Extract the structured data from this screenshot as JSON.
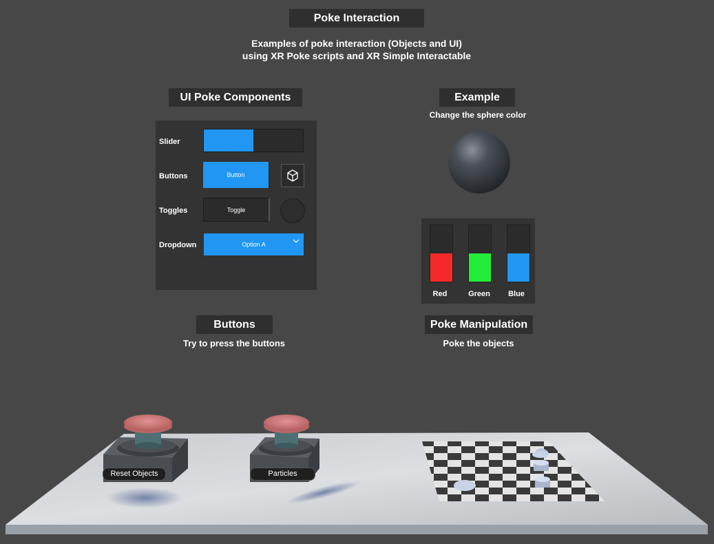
{
  "header": {
    "title": "Poke Interaction",
    "subtitle_line1": "Examples of poke interaction (Objects and UI)",
    "subtitle_line2": "using XR Poke scripts and XR Simple Interactable"
  },
  "ui_section": {
    "title": "UI Poke Components",
    "slider_label": "Slider",
    "slider_value": 0.5,
    "buttons_label": "Buttons",
    "button_text": "Button",
    "toggles_label": "Toggles",
    "toggle_text": "Toggle",
    "dropdown_label": "Dropdown",
    "dropdown_value": "Option A"
  },
  "example_section": {
    "title": "Example",
    "description": "Change the sphere color",
    "sliders": [
      {
        "label": "Red",
        "color": "#f42a2a",
        "level": 0.5
      },
      {
        "label": "Green",
        "color": "#22ee3a",
        "level": 0.5
      },
      {
        "label": "Blue",
        "color": "#2196f3",
        "level": 0.5
      }
    ]
  },
  "buttons_section": {
    "title": "Buttons",
    "description": "Try to press the buttons",
    "reset_label": "Reset Objects",
    "particles_label": "Particles"
  },
  "manipulation_section": {
    "title": "Poke Manipulation",
    "description": "Poke the objects"
  },
  "colors": {
    "accent": "#2196f3",
    "background": "#474747",
    "panel": "#333333",
    "button_cap": "#d87f7f"
  }
}
